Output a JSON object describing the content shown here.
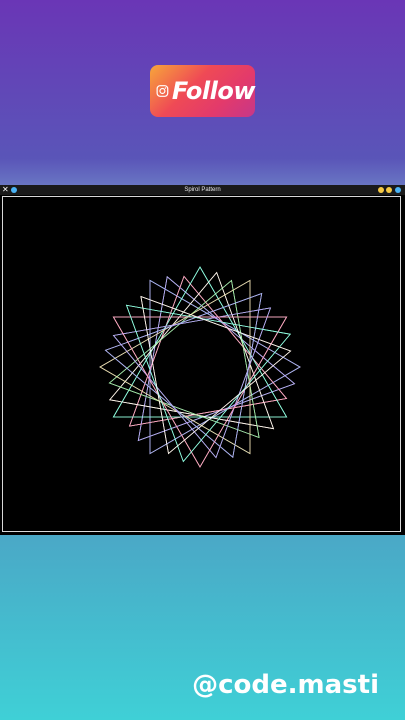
{
  "badge": {
    "label": "Follow",
    "icon": "instagram-icon"
  },
  "window": {
    "title": "Spirol Pattern",
    "close_glyph": "✕",
    "dot_colors": [
      "#4ab3f4",
      "#f6c944",
      "#f6c944",
      "#4ab3f4",
      "#ef5b5b"
    ]
  },
  "spiral": {
    "background": "#000000",
    "colors": [
      "#ffffff",
      "#9cff8a",
      "#f6e98a",
      "#8ab7ff",
      "#c78aff",
      "#ff8ab8",
      "#8afff0"
    ]
  },
  "footer": {
    "handle": "@code.masti"
  }
}
